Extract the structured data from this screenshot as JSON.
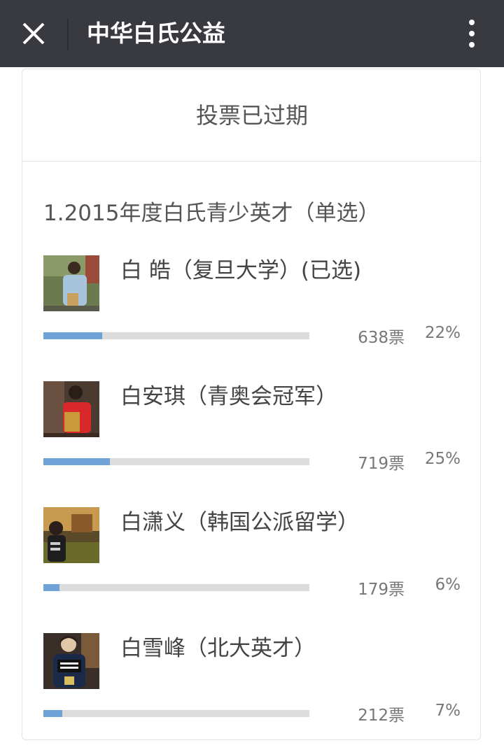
{
  "header": {
    "title": "中华白氏公益",
    "close_icon": "close-icon",
    "more_icon": "more-vertical-icon"
  },
  "poll": {
    "status": "投票已过期",
    "question": "1.2015年度白氏青少英才（单选）",
    "options": [
      {
        "label": "白  皓（复旦大学）(已选)",
        "votes": "638票",
        "percent": "22%",
        "fraction": 0.22
      },
      {
        "label": "白安琪（青奥会冠军）",
        "votes": "719票",
        "percent": "25%",
        "fraction": 0.25
      },
      {
        "label": "白潇义（韩国公派留学）",
        "votes": "179票",
        "percent": "6%",
        "fraction": 0.06
      },
      {
        "label": "白雪峰（北大英才）",
        "votes": "212票",
        "percent": "7%",
        "fraction": 0.07
      }
    ]
  },
  "colors": {
    "topbar": "#393a3f",
    "bar_fill": "#6fa3d8",
    "bar_track": "#dcdcdc"
  }
}
